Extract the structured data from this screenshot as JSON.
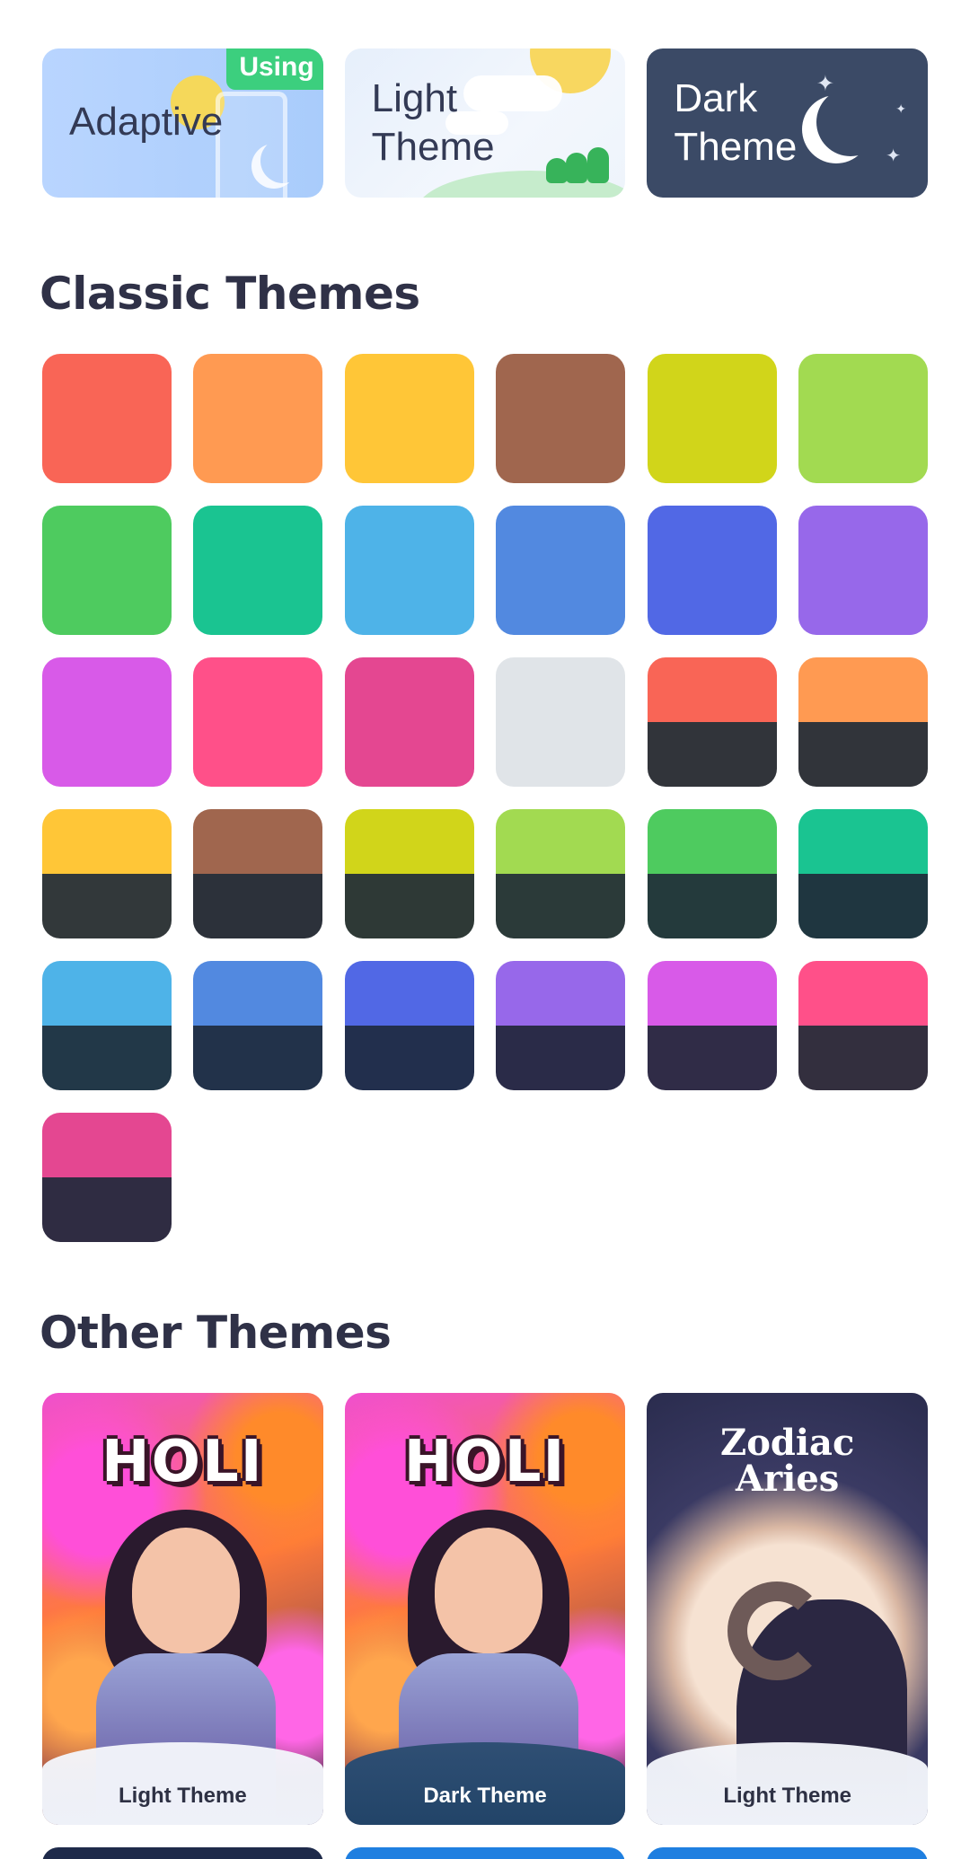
{
  "modes": {
    "adaptive": {
      "label": "Adaptive",
      "badge": "Using"
    },
    "light": {
      "label": "Light\nTheme"
    },
    "dark": {
      "label": "Dark\nTheme"
    }
  },
  "classic": {
    "title": "Classic Themes",
    "swatches": [
      {
        "top": "#f96556"
      },
      {
        "top": "#ff9a52"
      },
      {
        "top": "#ffc637"
      },
      {
        "top": "#a0664e"
      },
      {
        "top": "#d1d51a"
      },
      {
        "top": "#a2da51"
      },
      {
        "top": "#4ecb5f"
      },
      {
        "top": "#1ac491"
      },
      {
        "top": "#4eb3e8"
      },
      {
        "top": "#5289e0"
      },
      {
        "top": "#5168e5"
      },
      {
        "top": "#9768ea"
      },
      {
        "top": "#d85ae8"
      },
      {
        "top": "#ff5089"
      },
      {
        "top": "#e44791"
      },
      {
        "top": "#e0e4e8"
      },
      {
        "top": "#f96556",
        "bottom": "#31343a"
      },
      {
        "top": "#ff9a52",
        "bottom": "#31343a"
      },
      {
        "top": "#ffc637",
        "bottom": "#32383a"
      },
      {
        "top": "#a0664e",
        "bottom": "#2c313a"
      },
      {
        "top": "#d1d51a",
        "bottom": "#2e3936"
      },
      {
        "top": "#a2da51",
        "bottom": "#2b3a39"
      },
      {
        "top": "#4ecb5f",
        "bottom": "#243a3c"
      },
      {
        "top": "#1ac491",
        "bottom": "#1f3640"
      },
      {
        "top": "#4eb3e8",
        "bottom": "#223848"
      },
      {
        "top": "#5289e0",
        "bottom": "#22324a"
      },
      {
        "top": "#5168e5",
        "bottom": "#222f4d"
      },
      {
        "top": "#9768ea",
        "bottom": "#2a2b48"
      },
      {
        "top": "#d85ae8",
        "bottom": "#302c47"
      },
      {
        "top": "#ff5089",
        "bottom": "#332f3e"
      },
      {
        "top": "#e44791",
        "bottom": "#2f2c42"
      }
    ]
  },
  "other": {
    "title": "Other Themes",
    "cards": [
      {
        "art_title": "HOLI",
        "caption": "Light Theme"
      },
      {
        "art_title": "HOLI",
        "caption": "Dark Theme"
      },
      {
        "art_title": "Zodiac\nAries",
        "caption": "Light Theme"
      }
    ],
    "peek_colors": [
      "#1e2a4a",
      "#1f7fe0",
      "#1f7fe0"
    ]
  }
}
